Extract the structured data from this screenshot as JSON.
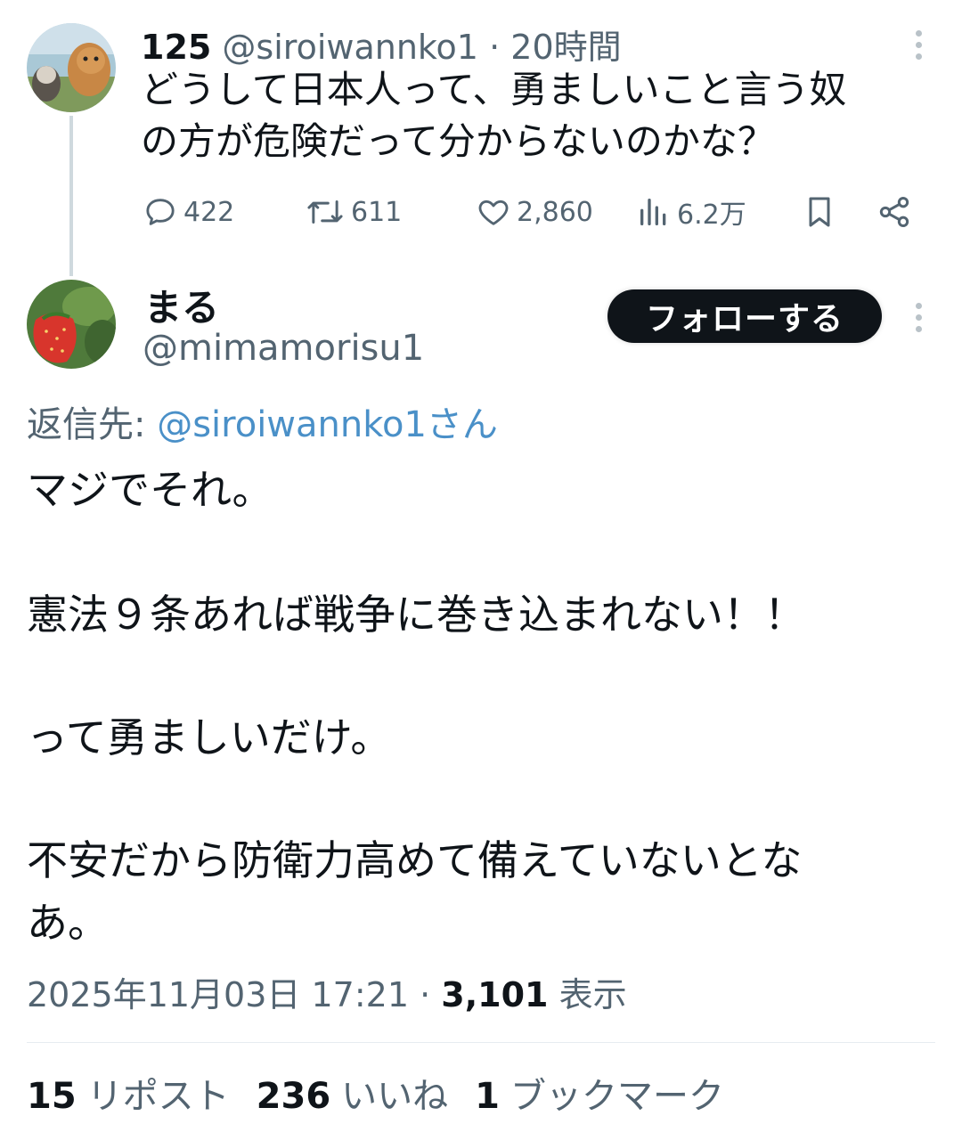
{
  "parent_tweet": {
    "display_name": "125",
    "handle": "@siroiwannko1",
    "separator": "·",
    "time": "20時間",
    "text_line1": "どうして日本人って、勇ましいこと言う奴",
    "text_line2": "の方が危険だって分からないのかな？",
    "actions": {
      "replies": "422",
      "reposts": "611",
      "likes": "2,860",
      "views": "6.2万"
    }
  },
  "main_tweet": {
    "display_name": "まる",
    "handle": "@mimamorisu1",
    "follow_label": "フォローする",
    "reply_to_label": "返信先:",
    "reply_to_handle": "@siroiwannko1さん",
    "paragraphs": [
      "マジでそれ。",
      "憲法９条あれば戦争に巻き込まれない！！",
      "って勇ましいだけ。",
      "不安だから防衛力高めて備えていないとな",
      "あ。"
    ],
    "timestamp": "2025年11月03日 17:21",
    "separator": "·",
    "views_count": "3,101",
    "views_label": "表示"
  },
  "stats": {
    "reposts_count": "15",
    "reposts_label": "リポスト",
    "likes_count": "236",
    "likes_label": "いいね",
    "bookmarks_count": "1",
    "bookmarks_label": "ブックマーク"
  },
  "icons": {
    "reply": "reply-icon",
    "repost": "repost-icon",
    "like": "heart-icon",
    "views": "views-icon",
    "bookmark": "bookmark-icon",
    "share": "share-icon",
    "more": "more-icon"
  },
  "colors": {
    "text": "#0f1419",
    "muted": "#536471",
    "link": "#4a90c8",
    "button": "#0f1419"
  }
}
